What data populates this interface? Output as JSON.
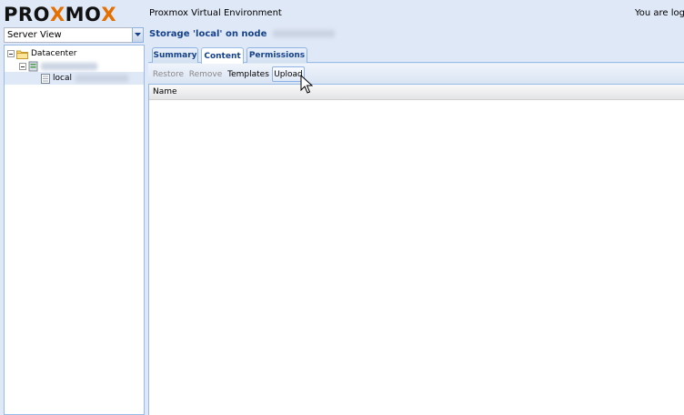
{
  "header": {
    "logo_letters": [
      {
        "ch": "P",
        "color": "#111111"
      },
      {
        "ch": "R",
        "color": "#111111"
      },
      {
        "ch": "O",
        "color": "#111111"
      },
      {
        "ch": "X",
        "color": "#e57000"
      },
      {
        "ch": "M",
        "color": "#111111"
      },
      {
        "ch": "O",
        "color": "#111111"
      },
      {
        "ch": "X",
        "color": "#e57000"
      }
    ],
    "app_title": "Proxmox Virtual Environment",
    "user_info": "You are logge"
  },
  "sidebar": {
    "view_select": "Server View",
    "tree": [
      {
        "label": "Datacenter",
        "icon": "folder-icon"
      },
      {
        "label": "",
        "icon": "server-icon"
      },
      {
        "label": "local",
        "icon": "storage-icon",
        "selected": true
      }
    ]
  },
  "main": {
    "title": "Storage 'local' on node",
    "tabs": [
      "Summary",
      "Content",
      "Permissions"
    ],
    "active_tab": "Content",
    "toolbar": {
      "restore": "Restore",
      "remove": "Remove",
      "templates": "Templates",
      "upload": "Upload"
    },
    "grid": {
      "columns": [
        "Name"
      ]
    }
  },
  "colors": {
    "accent": "#15428b",
    "panel_border": "#99bbe8",
    "background": "#dfe8f6",
    "logo_orange": "#e57000"
  }
}
